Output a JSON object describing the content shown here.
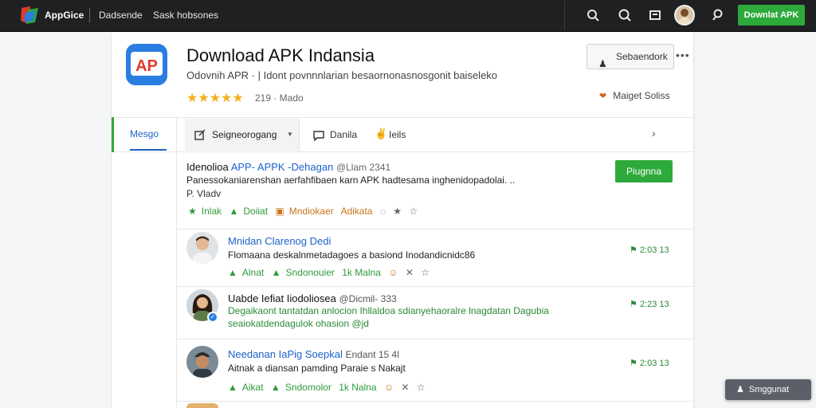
{
  "topbar": {
    "brand": "AppGice",
    "nav": [
      "Dadsende",
      "Sask hobsones"
    ],
    "download_label": "Downlat APK"
  },
  "app": {
    "title": "Download APK Indansia",
    "subtitle": "Odovnih APR  ·  |  Idont povnnnlarian  besaornonasnosgonit baiseleko",
    "stars": "★★★★★",
    "rating": "219  ·  Mado",
    "subscribe_label": "Sebaendork",
    "more": "•••",
    "manage_label": "Maiget Soliss"
  },
  "tabs": {
    "active": "Mesgo",
    "segment": "Seigneorogang",
    "comments": "Danila",
    "likes": "Ieils"
  },
  "post": {
    "author": "Idenolioa",
    "highlight": "APP- APPK -Dehagan",
    "meta": "@Llam 2341",
    "body": "Panessokaniarenshan aerfahfibaen karn APK hadtesama inghenidopadolai.  ..",
    "tag": "P. Vladv",
    "button": "Piugnna",
    "actions": [
      "Inlak",
      "Doiiat",
      "Mndiokaer",
      "Adikata"
    ]
  },
  "comments": [
    {
      "name": "Mnidan Clarenog Dedi",
      "meta": "",
      "text": "Flomaana deskalnmetadagoes a basiond Inodandicnidc86",
      "time": "2:03 13",
      "actions": [
        "Alnat",
        "Sndonouier",
        "1k Malna"
      ]
    },
    {
      "name": "Uabde Iefiat Iiodoliosea",
      "meta": "@Dicmil- 333",
      "text": "Degaikaont tantatdan anlocion Ihllaldoa sdianyehaoralre lnagdatan Dagubia",
      "text2": "seaiokatdendagulok  ohasion @jd",
      "time": "2:23 13",
      "actions": []
    },
    {
      "name": "Needanan IaPig Soepkal",
      "meta": "Endant 15 4l",
      "text": "Aitnak a diansan pamding Paraie s Nakajt",
      "time": "2:03 13",
      "actions": [
        "Aikat",
        "Sndomolor",
        "1k Nalna"
      ]
    }
  ],
  "toast": "Smggunat"
}
